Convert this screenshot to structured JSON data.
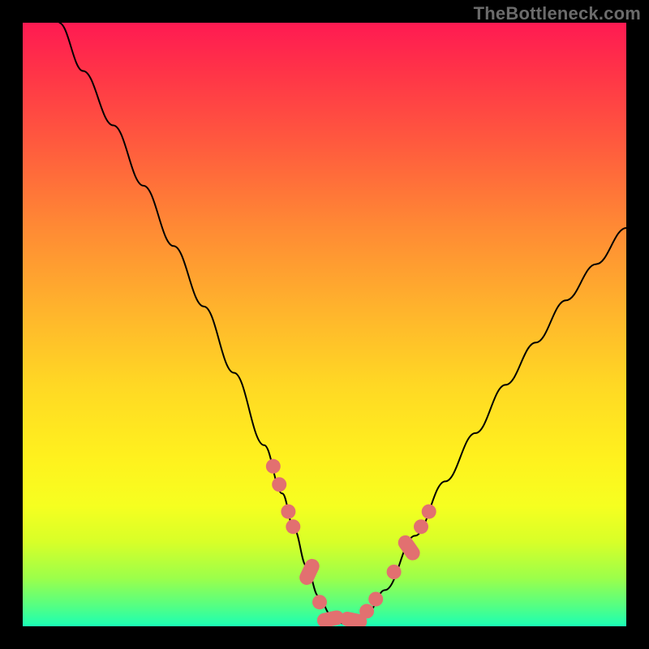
{
  "watermark": "TheBottleneck.com",
  "chart_data": {
    "type": "line",
    "title": "",
    "xlabel": "",
    "ylabel": "",
    "xlim": [
      0,
      100
    ],
    "ylim": [
      0,
      100
    ],
    "series": [
      {
        "name": "curve",
        "x": [
          6,
          10,
          15,
          20,
          25,
          30,
          35,
          40,
          43,
          45,
          47,
          49,
          51,
          53,
          55,
          57,
          60,
          65,
          70,
          75,
          80,
          85,
          90,
          95,
          100
        ],
        "y": [
          100,
          92,
          83,
          73,
          63,
          53,
          42,
          30,
          22,
          16,
          10,
          5,
          2,
          0.5,
          0.5,
          2,
          6,
          15,
          24,
          32,
          40,
          47,
          54,
          60,
          66
        ]
      }
    ],
    "markers": [
      {
        "kind": "dot",
        "x": 41.5,
        "y": 26.5
      },
      {
        "kind": "dot",
        "x": 42.5,
        "y": 23.5
      },
      {
        "kind": "dot",
        "x": 44.0,
        "y": 19.0
      },
      {
        "kind": "dot",
        "x": 44.8,
        "y": 16.5
      },
      {
        "kind": "pill",
        "x": 47.5,
        "y": 9.0,
        "len": 4.5,
        "angle": -65
      },
      {
        "kind": "dot",
        "x": 49.2,
        "y": 4.0
      },
      {
        "kind": "pill",
        "x": 51.0,
        "y": 1.2,
        "len": 4.5,
        "angle": -12
      },
      {
        "kind": "pill",
        "x": 54.8,
        "y": 1.0,
        "len": 4.5,
        "angle": 12
      },
      {
        "kind": "dot",
        "x": 57.0,
        "y": 2.5
      },
      {
        "kind": "dot",
        "x": 58.5,
        "y": 4.5
      },
      {
        "kind": "dot",
        "x": 61.5,
        "y": 9.0
      },
      {
        "kind": "pill",
        "x": 64.0,
        "y": 13.0,
        "len": 4.5,
        "angle": 55
      },
      {
        "kind": "dot",
        "x": 66.0,
        "y": 16.5
      },
      {
        "kind": "dot",
        "x": 67.3,
        "y": 19.0
      }
    ],
    "marker_color": "#e27070"
  }
}
